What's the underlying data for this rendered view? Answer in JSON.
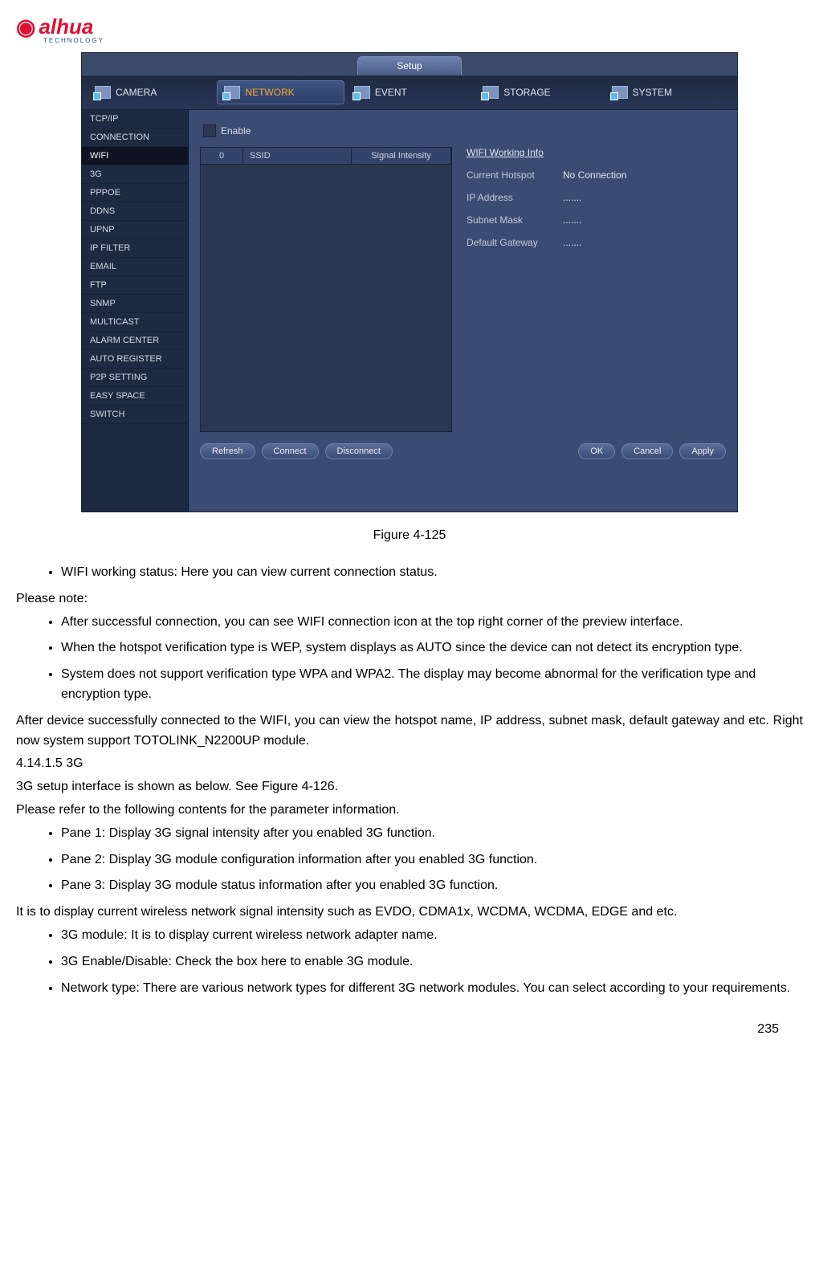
{
  "logo": {
    "brand": "alhua",
    "sub": "TECHNOLOGY"
  },
  "ui": {
    "setup_tab": "Setup",
    "topnav": [
      "CAMERA",
      "NETWORK",
      "EVENT",
      "STORAGE",
      "SYSTEM"
    ],
    "sidenav": [
      "TCP/IP",
      "CONNECTION",
      "WIFI",
      "3G",
      "PPPOE",
      "DDNS",
      "UPNP",
      "IP FILTER",
      "EMAIL",
      "FTP",
      "SNMP",
      "MULTICAST",
      "ALARM CENTER",
      "AUTO REGISTER",
      "P2P SETTING",
      "EASY SPACE",
      "SWITCH"
    ],
    "enable_label": "Enable",
    "cols": {
      "c0": "0",
      "c1": "SSID",
      "c2": "Signal Intensity"
    },
    "info": {
      "title": "WIFI Working Info",
      "hotspot_lbl": "Current Hotspot",
      "hotspot_val": "No Connection",
      "ip_lbl": "IP Address",
      "ip_val": ".......",
      "mask_lbl": "Subnet Mask",
      "mask_val": ".......",
      "gw_lbl": "Default Gateway",
      "gw_val": "......."
    },
    "buttons": {
      "refresh": "Refresh",
      "connect": "Connect",
      "disconnect": "Disconnect",
      "ok": "OK",
      "cancel": "Cancel",
      "apply": "Apply"
    }
  },
  "doc": {
    "figure": "Figure 4-125",
    "b1": "WIFI working status: Here you can view current connection status.",
    "note": "Please note:",
    "b2": "After successful connection, you can see WIFI connection icon at the top right corner of the preview interface.",
    "b3": "When the hotspot verification type is WEP, system displays as AUTO since the device can not detect its encryption type.",
    "b4": "System does not support verification type WPA and WPA2. The display may become abnormal for the verification type and encryption type.",
    "p1": "After device successfully connected to the WIFI, you can view the hotspot name, IP address, subnet mask, default gateway and etc. Right now system support TOTOLINK_N2200UP module.",
    "sec": "4.14.1.5  3G",
    "p2": "3G setup interface is shown as below. See Figure 4-126.",
    "p3": "Please refer to the following contents for the parameter information.",
    "b5": "Pane 1: Display 3G signal intensity after you enabled 3G function.",
    "b6": "Pane 2: Display 3G module configuration information after you enabled 3G function.",
    "b7": "Pane 3: Display 3G module status information after you enabled 3G function.",
    "p4": "It is to display current wireless network signal intensity such as EVDO, CDMA1x, WCDMA, WCDMA, EDGE and etc.",
    "b8": "3G module: It is to display current wireless network adapter name.",
    "b9": "3G Enable/Disable: Check the box here to enable 3G module.",
    "b10": "Network type: There are various network types for different 3G network modules. You can select according to your requirements.",
    "page": "235"
  }
}
